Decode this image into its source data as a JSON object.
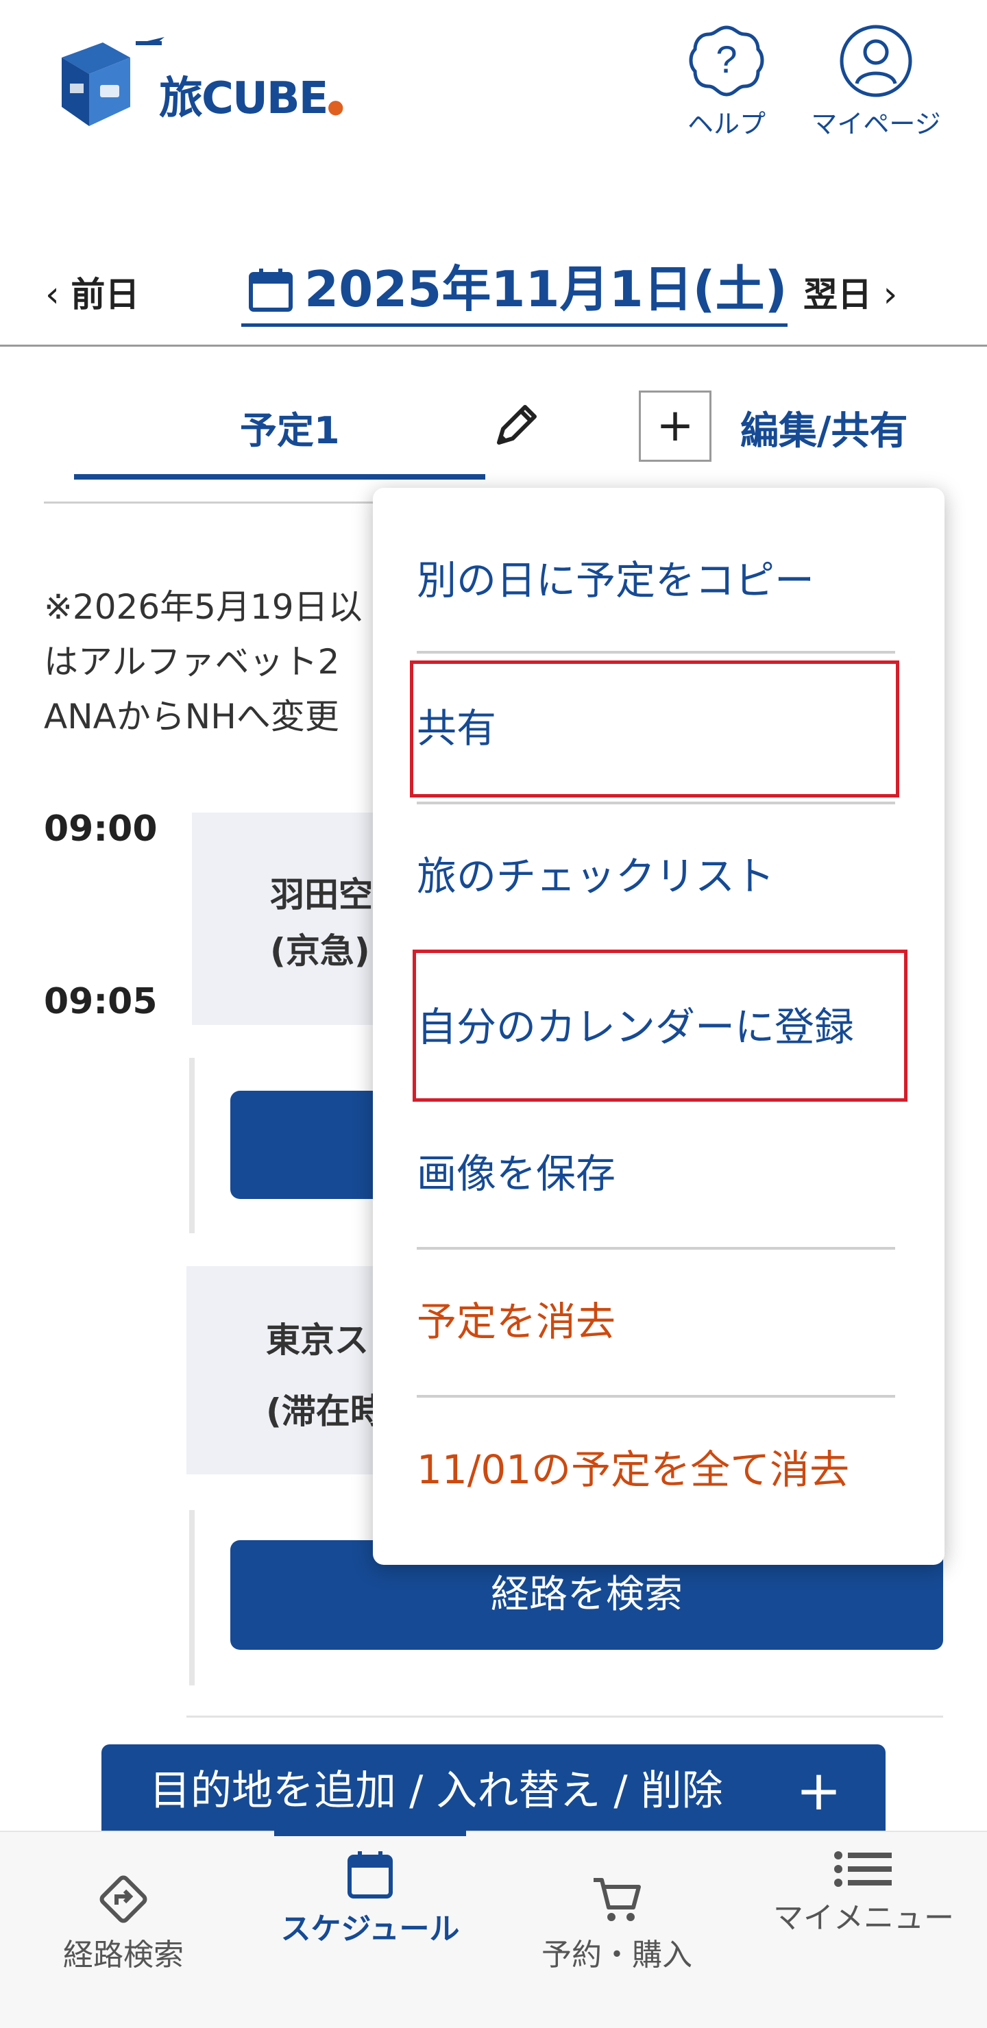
{
  "header": {
    "logo_text": "旅CUBE",
    "help_label": "ヘルプ",
    "mypage_label": "マイページ"
  },
  "date_nav": {
    "prev_label": "前日",
    "date_label": "2025年11月1日(土)",
    "next_label": "翌日"
  },
  "plan_tabs": {
    "active_tab": "予定1",
    "add_label": "+",
    "edit_share_label": "編集/共有"
  },
  "notice": {
    "line1": "※2026年5月19日以",
    "line2": "はアルファベット2",
    "line3": "ANAからNHへ変更"
  },
  "schedule": {
    "time1": "09:00",
    "time2": "09:05",
    "stop1_line1": "羽田空",
    "stop1_line2": "(京急)",
    "stop2_line1": "東京ス",
    "stop2_line2": "(滞在時",
    "route_button": "経路を検索",
    "add_destination": "目的地を追加 / 入れ替え / 削除"
  },
  "menu": {
    "items": [
      "別の日に予定をコピー",
      "共有",
      "旅のチェックリスト",
      "自分のカレンダーに登録",
      "画像を保存",
      "予定を消去",
      "11/01の予定を全て消去"
    ]
  },
  "bottom_nav": {
    "route": "経路検索",
    "schedule": "スケジュール",
    "booking": "予約・購入",
    "mymenu": "マイメニュー"
  },
  "colors": {
    "brand_blue": "#164a94",
    "danger": "#cc4a10",
    "highlight_red": "#d61d2a",
    "card_bg": "#eef0f5"
  }
}
